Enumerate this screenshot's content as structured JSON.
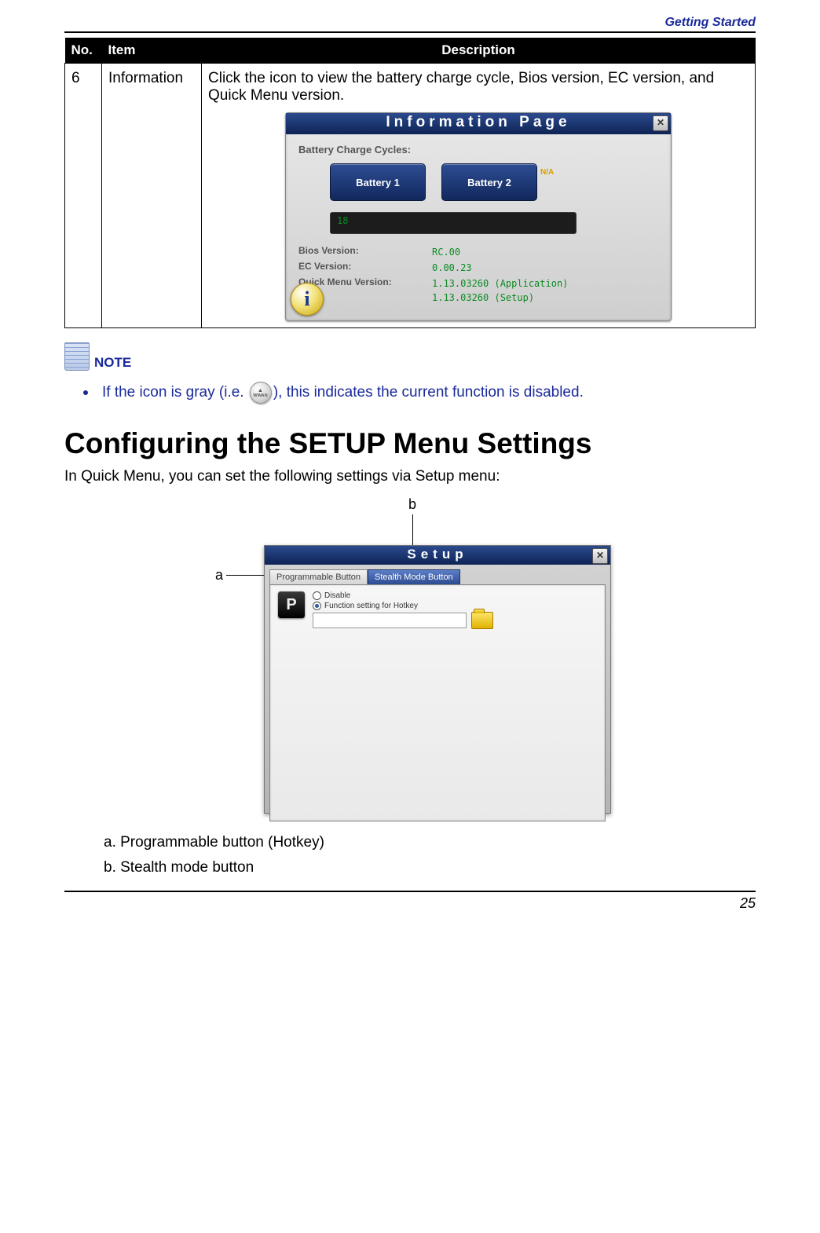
{
  "header": {
    "section": "Getting Started"
  },
  "table": {
    "headers": {
      "no": "No.",
      "item": "Item",
      "desc": "Description"
    },
    "row": {
      "no": "6",
      "item": "Information",
      "desc": "Click the icon to view the battery charge cycle, Bios version, EC version, and Quick Menu version."
    }
  },
  "info_panel": {
    "title": "Information Page",
    "close": "✕",
    "batt_label": "Battery Charge Cycles:",
    "batt1": "Battery 1",
    "batt2": "Battery 2",
    "na": "N/A",
    "count": "18",
    "bios_k": "Bios Version:",
    "bios_v": "RC.00",
    "ec_k": "EC Version:",
    "ec_v": "0.00.23",
    "qm_k": "Quick Menu Version:",
    "qm_v1": "1.13.03260 (Application)",
    "qm_v2": "1.13.03260 (Setup)",
    "corner": "i"
  },
  "note": {
    "label": "NOTE",
    "text_pre": "If the icon is gray (i.e. ",
    "text_post": "), this indicates the current function is disabled.",
    "icon_text": "WWAN"
  },
  "heading": "Configuring the SETUP Menu Settings",
  "intro": "In Quick Menu, you can set the following settings via Setup menu:",
  "callouts": {
    "a": "a",
    "b": "b"
  },
  "setup_panel": {
    "title": "Setup",
    "close": "✕",
    "tab1": "Programmable Button",
    "tab2": "Stealth Mode Button",
    "p_key": "P",
    "opt_disable": "Disable",
    "opt_hotkey": "Function setting for Hotkey"
  },
  "list": {
    "a": "a.  Programmable button (Hotkey)",
    "b": "b.  Stealth mode button"
  },
  "page_number": "25"
}
